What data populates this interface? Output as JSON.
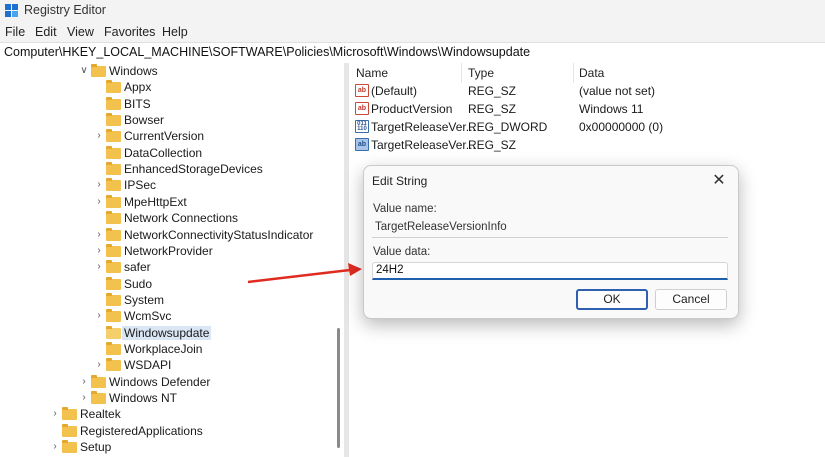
{
  "window": {
    "title": "Registry Editor"
  },
  "menu": [
    "File",
    "Edit",
    "View",
    "Favorites",
    "Help"
  ],
  "address": "Computer\\HKEY_LOCAL_MACHINE\\SOFTWARE\\Policies\\Microsoft\\Windows\\Windowsupdate",
  "tree": [
    {
      "label": "Windows",
      "expander": "expanded"
    },
    {
      "label": "Appx",
      "expander": "none"
    },
    {
      "label": "BITS",
      "expander": "none"
    },
    {
      "label": "Bowser",
      "expander": "none"
    },
    {
      "label": "CurrentVersion",
      "expander": "collapsed"
    },
    {
      "label": "DataCollection",
      "expander": "none"
    },
    {
      "label": "EnhancedStorageDevices",
      "expander": "none"
    },
    {
      "label": "IPSec",
      "expander": "collapsed"
    },
    {
      "label": "MpeHttpExt",
      "expander": "collapsed"
    },
    {
      "label": "Network Connections",
      "expander": "none"
    },
    {
      "label": "NetworkConnectivityStatusIndicator",
      "expander": "collapsed"
    },
    {
      "label": "NetworkProvider",
      "expander": "collapsed"
    },
    {
      "label": "safer",
      "expander": "collapsed"
    },
    {
      "label": "Sudo",
      "expander": "none"
    },
    {
      "label": "System",
      "expander": "none"
    },
    {
      "label": "WcmSvc",
      "expander": "collapsed"
    },
    {
      "label": "Windowsupdate",
      "expander": "none",
      "selected": true
    },
    {
      "label": "WorkplaceJoin",
      "expander": "none"
    },
    {
      "label": "WSDAPI",
      "expander": "collapsed"
    },
    {
      "label": "Windows Defender",
      "expander": "collapsed"
    },
    {
      "label": "Windows NT",
      "expander": "collapsed"
    },
    {
      "label": "Realtek",
      "expander": "collapsed"
    },
    {
      "label": "RegisteredApplications",
      "expander": "none"
    },
    {
      "label": "Setup",
      "expander": "collapsed"
    }
  ],
  "list": {
    "columns": [
      "Name",
      "Type",
      "Data"
    ],
    "rows": [
      {
        "icon": "string-value-icon",
        "name": "(Default)",
        "type": "REG_SZ",
        "data": "(value not set)"
      },
      {
        "icon": "string-value-icon",
        "name": "ProductVersion",
        "type": "REG_SZ",
        "data": "Windows 11"
      },
      {
        "icon": "dword-value-icon",
        "name": "TargetReleaseVer...",
        "type": "REG_DWORD",
        "data": "0x00000000 (0)"
      },
      {
        "icon": "string-value-selected-icon",
        "name": "TargetReleaseVer...",
        "type": "REG_SZ",
        "data": ""
      }
    ]
  },
  "dialog": {
    "title": "Edit String",
    "close_glyph": "✕",
    "value_name_label": "Value name:",
    "value_name": "TargetReleaseVersionInfo",
    "value_data_label": "Value data:",
    "value_data": "24H2",
    "ok_label": "OK",
    "cancel_label": "Cancel"
  },
  "icons": {
    "string_glyph": "ab",
    "binary_glyph": "011 110"
  },
  "colors": {
    "folder": "#f2c14e",
    "selection": "#dbe6f4",
    "arrow": "#e02b20",
    "accent": "#1f5fad"
  }
}
